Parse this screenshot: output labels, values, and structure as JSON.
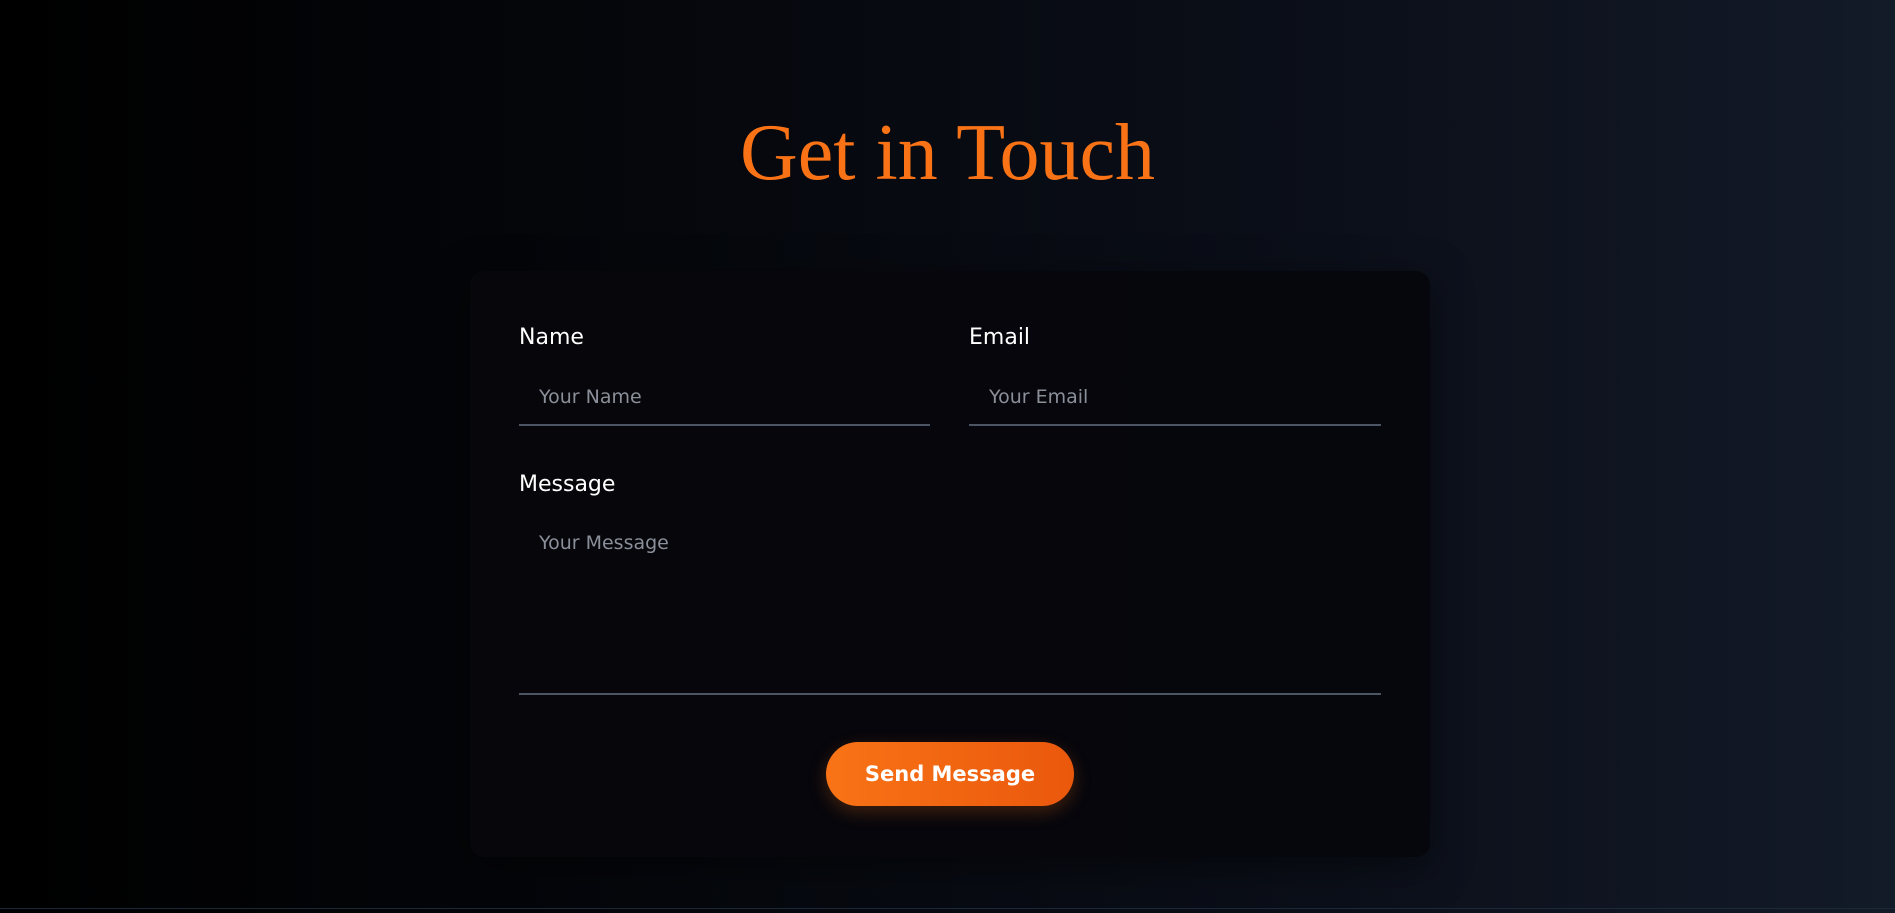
{
  "header": {
    "title": "Get in Touch"
  },
  "form": {
    "name": {
      "label": "Name",
      "placeholder": "Your Name",
      "value": ""
    },
    "email": {
      "label": "Email",
      "placeholder": "Your Email",
      "value": ""
    },
    "message": {
      "label": "Message",
      "placeholder": "Your Message",
      "value": ""
    },
    "submit_label": "Send Message"
  },
  "colors": {
    "accent": "#f97316",
    "accent_dark": "#ea580c",
    "background_start": "#000000",
    "background_end": "#131a28",
    "card_background": "#06070c",
    "field_underline": "#4b5563",
    "placeholder_text": "#8a8f99"
  }
}
